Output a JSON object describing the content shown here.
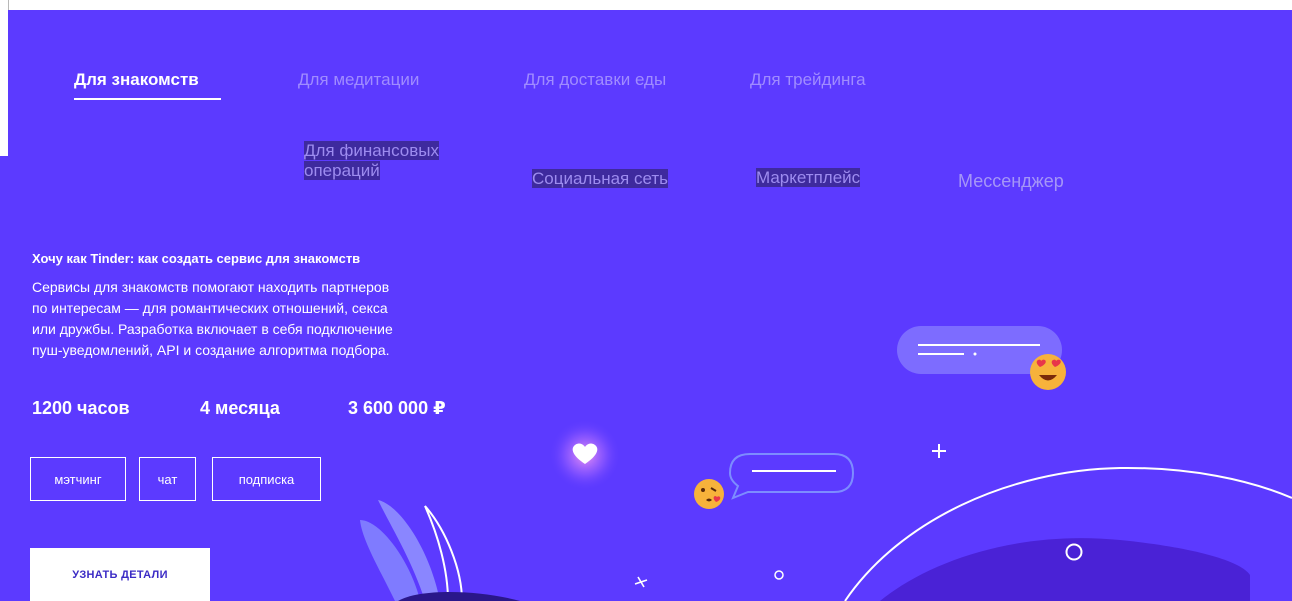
{
  "tabs_row1": [
    {
      "label": "Для знакомств",
      "active": true
    },
    {
      "label": "Для медитации",
      "active": false
    },
    {
      "label": "Для доставки еды",
      "active": false
    },
    {
      "label": "Для трейдинга",
      "active": false
    }
  ],
  "tabs_row2": [
    {
      "label_line1": "Для финансовых",
      "label_line2": "операций"
    },
    {
      "label": "Социальная сеть"
    },
    {
      "label": "Маркетплейс"
    },
    {
      "label": "Мессенджер"
    }
  ],
  "project": {
    "title": "Хочу как Tinder: как создать сервис для знакомств",
    "description_lines": [
      "Сервисы для знакомств помогают находить партнеров",
      "по интересам — для романтических отношений, секса",
      "или дружбы. Разработка включает в себя подключение",
      "пуш-уведомлений, API и создание алгоритма подбора."
    ],
    "stats": {
      "hours": "1200 часов",
      "duration": "4 месяца",
      "price": "3 600 000 ₽"
    },
    "tags": [
      "мэтчинг",
      "чат",
      "подписка"
    ],
    "cta_label": "УЗНАТЬ ДЕТАЛИ"
  },
  "colors": {
    "background": "#5c3aff",
    "text": "#ffffff",
    "tab_inactive": "#a08cff",
    "bubble": "#7d6cff",
    "emoji": "#f7b23b"
  },
  "icons": [
    "heart-icon",
    "heart-eyes-emoji-icon",
    "kissing-emoji-icon",
    "plus-sparkle-icon",
    "circle-sparkle-icon"
  ]
}
